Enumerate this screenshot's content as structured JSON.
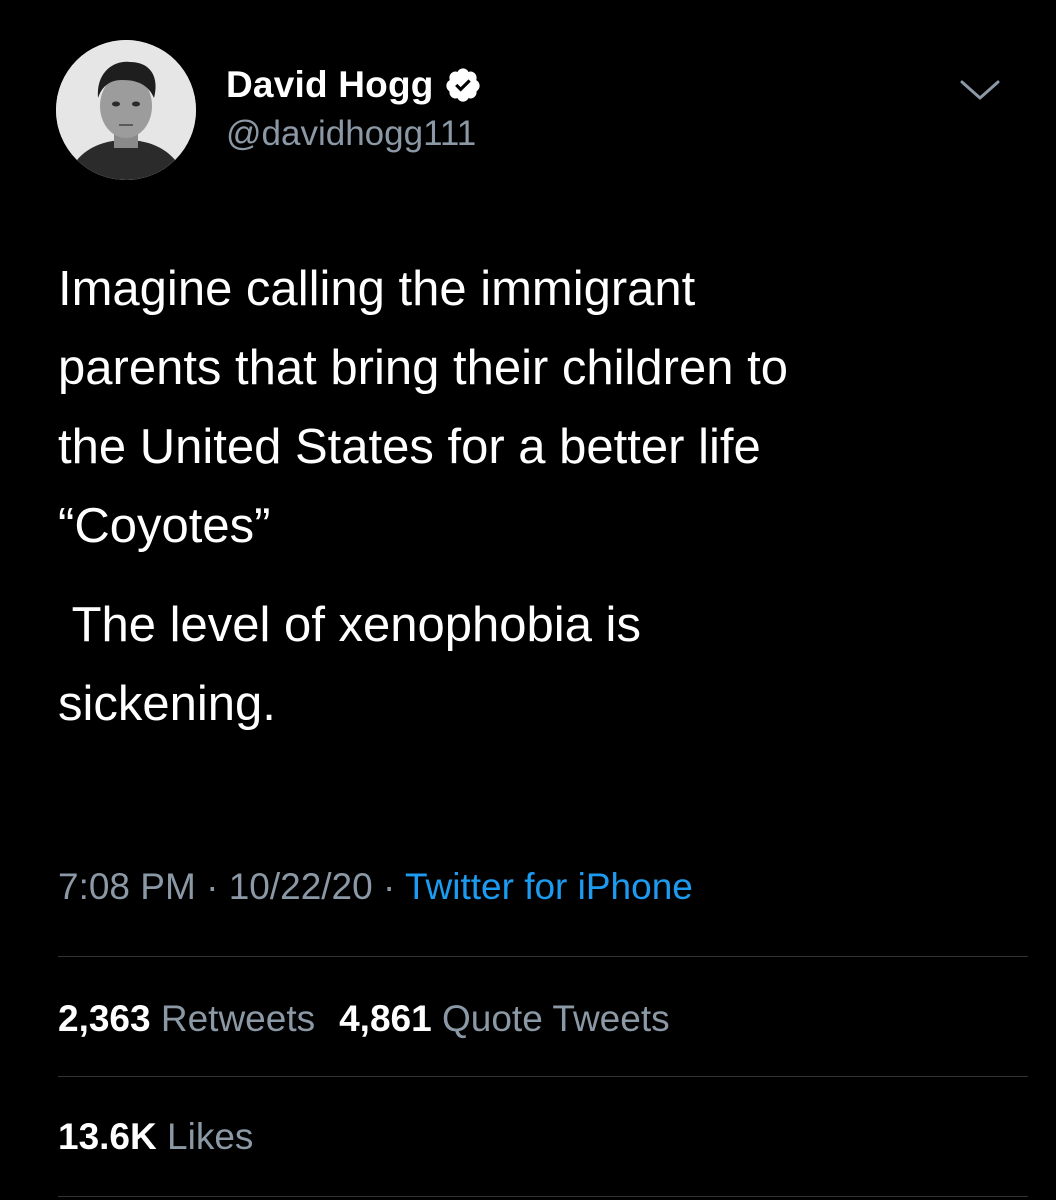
{
  "author": {
    "display_name": "David Hogg",
    "handle": "@davidhogg111",
    "verified_icon": "verified-badge-icon"
  },
  "tweet": {
    "paragraphs": [
      "Imagine calling the immigrant\nparents that bring their children to\nthe United States for a better life\n“Coyotes”",
      " The level of xenophobia is\nsickening."
    ],
    "time": "7:08 PM",
    "date": "10/22/20",
    "separator": "·",
    "source": "Twitter for iPhone"
  },
  "stats": {
    "retweets_count": "2,363",
    "retweets_label": "Retweets",
    "quotes_count": "4,861",
    "quotes_label": "Quote Tweets",
    "likes_count": "13.6K",
    "likes_label": "Likes"
  },
  "colors": {
    "background": "#000000",
    "text": "#ffffff",
    "secondary": "#8b98a5",
    "link": "#1d9bf0",
    "divider": "#2f3336"
  }
}
